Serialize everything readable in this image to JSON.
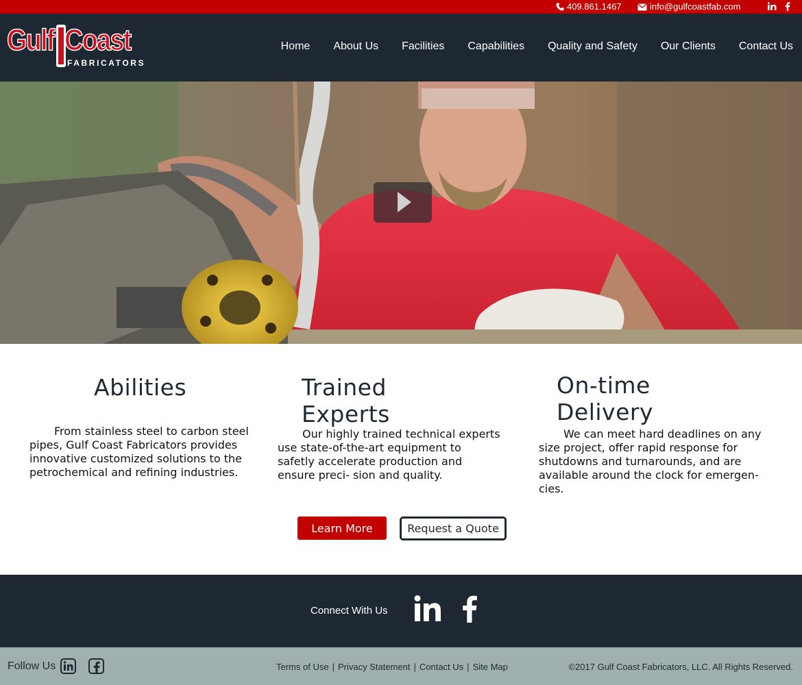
{
  "topbar": {
    "phone": "409.861.1467",
    "email": "info@gulfcoastfab.com",
    "icons": [
      "phone-icon",
      "envelope-icon",
      "linkedin-icon",
      "facebook-icon"
    ]
  },
  "brand": {
    "name_part1": "Gulf",
    "name_part2": "Coast",
    "tagline": "FABRICATORS"
  },
  "nav": {
    "items": [
      "Home",
      "About Us",
      "Facilities",
      "Capabilities",
      "Quality and Safety",
      "Our Clients",
      "Contact Us"
    ]
  },
  "features": [
    {
      "title": "Abilities",
      "text": "From stainless steel to carbon steel pipes, Gulf Coast Fabricators provides innovative customized solutions to the petrochemical and refining industries."
    },
    {
      "title": "Trained Experts",
      "text": "Our highly trained technical experts use state-of-the-art equipment to safetly accelerate production and ensure preci- sion and quality."
    },
    {
      "title": "On-time Delivery",
      "text": "We can meet hard deadlines on any size project, offer rapid response for shutdowns and turnarounds, and are available around the clock for emergen- cies."
    }
  ],
  "buttons": {
    "learn_more": "Learn More",
    "request_quote": "Request a Quote"
  },
  "connect": {
    "label": "Connect With Us"
  },
  "footer": {
    "follow_label": "Follow Us",
    "links": [
      "Terms of Use",
      "Privacy Statement",
      "Contact Us",
      "Site Map"
    ],
    "separator": "|",
    "copyright": "©2017 Gulf Coast Fabricators, LLC. All Rights Reserved."
  },
  "colors": {
    "brand_red": "#c30000",
    "header_dark": "#1e2832",
    "footer_gray": "#9fb0ae"
  }
}
